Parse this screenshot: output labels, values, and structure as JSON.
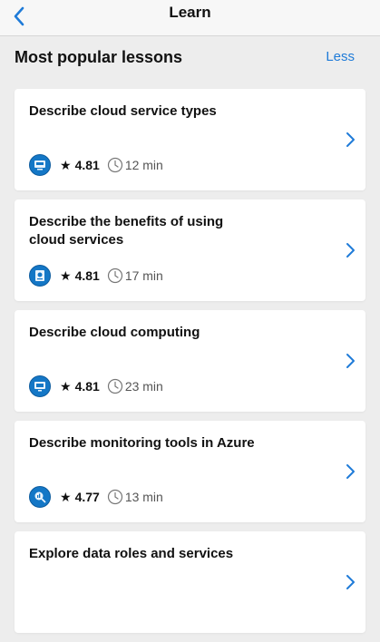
{
  "nav": {
    "title": "Learn"
  },
  "section": {
    "title": "Most popular lessons",
    "action_label": "Less"
  },
  "colors": {
    "accent": "#1f7bd8",
    "icon_blue": "#1477c6"
  },
  "lessons": [
    {
      "title": "Describe cloud service types",
      "rating": "4.81",
      "duration": "12 min",
      "icon": "cloud-service-icon"
    },
    {
      "title": "Describe the benefits of using cloud services",
      "rating": "4.81",
      "duration": "17 min",
      "icon": "cloud-benefits-icon"
    },
    {
      "title": "Describe cloud computing",
      "rating": "4.81",
      "duration": "23 min",
      "icon": "cloud-computing-icon"
    },
    {
      "title": "Describe monitoring tools in Azure",
      "rating": "4.77",
      "duration": "13 min",
      "icon": "monitoring-icon"
    },
    {
      "title": "Explore data roles and services",
      "rating": "",
      "duration": "",
      "icon": ""
    }
  ]
}
